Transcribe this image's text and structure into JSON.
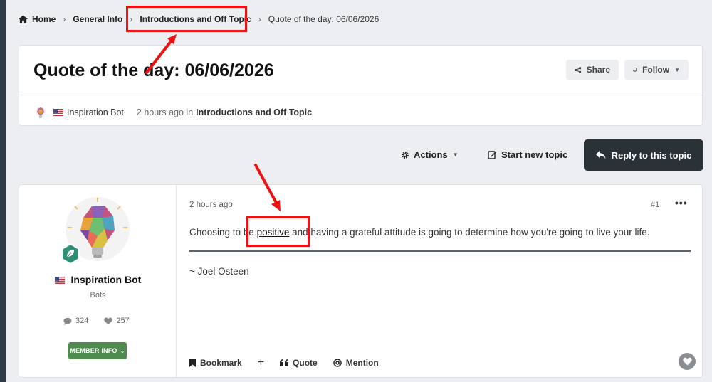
{
  "breadcrumb": {
    "home": "Home",
    "general": "General Info",
    "forum": "Introductions and Off Topic",
    "current": "Quote of the day: 06/06/2026"
  },
  "topic": {
    "title": "Quote of the day: 06/06/2026",
    "share_label": "Share",
    "follow_label": "Follow",
    "author": "Inspiration Bot",
    "time_text": "2 hours ago in",
    "forum_link": "Introductions and Off Topic"
  },
  "toolbar": {
    "actions_label": "Actions",
    "start_topic_label": "Start new topic",
    "reply_label": "Reply to this topic"
  },
  "post": {
    "time": "2 hours ago",
    "number": "#1",
    "more": "•••",
    "text_before": "Choosing to be ",
    "text_highlight": "positive",
    "text_after": " and having a grateful attitude is going to determine how you're going to live your life.",
    "author_line": "~ Joel Osteen",
    "author_name": "Inspiration Bot",
    "author_group": "Bots",
    "comments_count": "324",
    "likes_count": "257",
    "member_info_label": "MEMBER INFO",
    "actions": {
      "bookmark": "Bookmark",
      "plus": "+",
      "quote": "Quote",
      "mention": "Mention"
    }
  },
  "colors": {
    "reply_button_bg": "#2a3137",
    "member_button_bg": "#4f8a4f",
    "annotation": "#ee1111"
  },
  "icons": [
    "home-icon",
    "chevron-right-icon",
    "share-icon",
    "bell-icon",
    "gear-icon",
    "edit-icon",
    "reply-icon",
    "comment-icon",
    "heart-icon",
    "bookmark-icon",
    "quote-icon",
    "at-icon"
  ]
}
